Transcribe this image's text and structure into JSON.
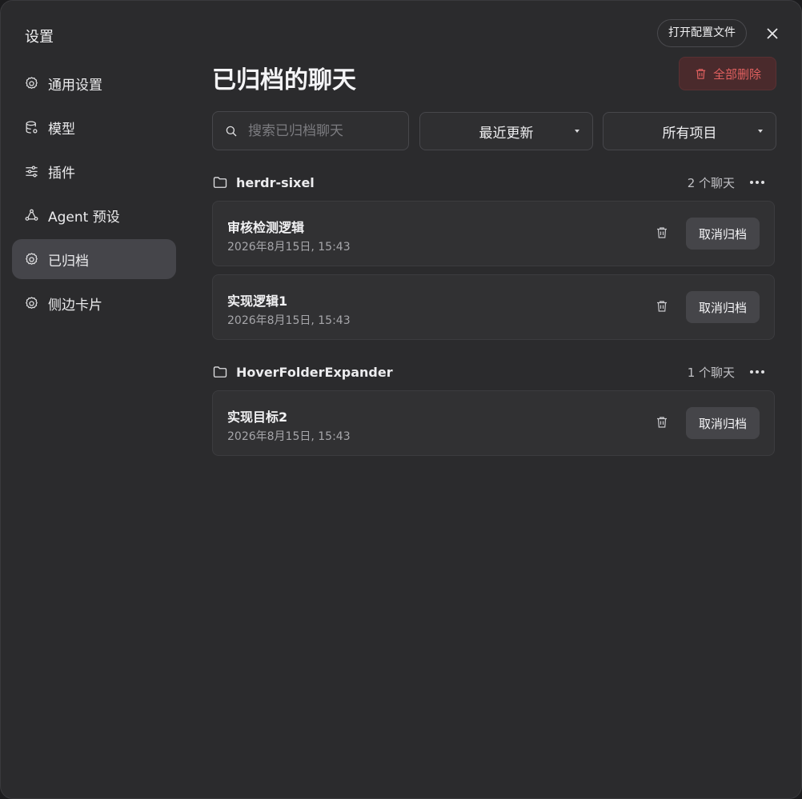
{
  "sidebar": {
    "title": "设置",
    "items": [
      {
        "label": "通用设置",
        "icon": "gear-icon"
      },
      {
        "label": "模型",
        "icon": "database-icon"
      },
      {
        "label": "插件",
        "icon": "sliders-icon"
      },
      {
        "label": "Agent 预设",
        "icon": "agent-icon"
      },
      {
        "label": "已归档",
        "icon": "gear-icon",
        "active": true
      },
      {
        "label": "侧边卡片",
        "icon": "gear-icon"
      }
    ]
  },
  "header": {
    "open_config_label": "打开配置文件",
    "title": "已归档的聊天",
    "delete_all_label": "全部删除"
  },
  "toolbar": {
    "search_placeholder": "搜索已归档聊天",
    "sort_value": "最近更新",
    "filter_value": "所有项目"
  },
  "groups": [
    {
      "name": "herdr-sixel",
      "count_label": "2 个聊天",
      "chats": [
        {
          "title": "审核检测逻辑",
          "date": "2026年8月15日, 15:43",
          "action_label": "取消归档"
        },
        {
          "title": "实现逻辑1",
          "date": "2026年8月15日, 15:43",
          "action_label": "取消归档"
        }
      ]
    },
    {
      "name": "HoverFolderExpander",
      "count_label": "1 个聊天",
      "chats": [
        {
          "title": "实现目标2",
          "date": "2026年8月15日, 15:43",
          "action_label": "取消归档"
        }
      ]
    }
  ],
  "colors": {
    "background": "#2b2b2d",
    "active_nav": "#45454a",
    "danger_text": "#e0605f",
    "danger_bg": "#4a2a2c"
  }
}
